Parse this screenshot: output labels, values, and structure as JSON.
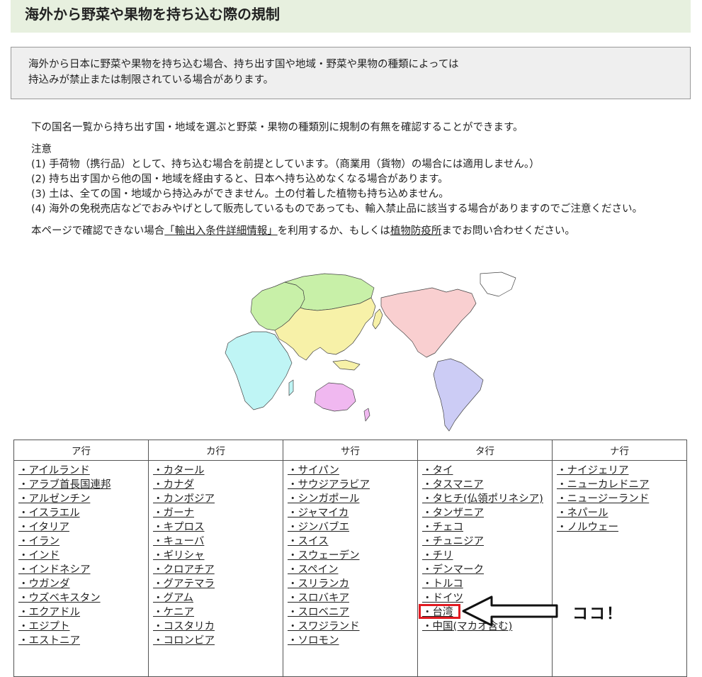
{
  "page": {
    "title": "海外から野菜や果物を持ち込む際の規制"
  },
  "intro": {
    "line1": "海外から日本に野菜や果物を持ち込む場合、持ち出す国や地域・野菜や果物の種類によっては",
    "line2": "持込みが禁止または制限されている場合があります。"
  },
  "body": {
    "lead": "下の国名一覧から持ち出す国・地域を選ぶと野菜・果物の種類別に規制の有無を確認することができます。",
    "notes_title": "注意",
    "notes": [
      "(1) 手荷物（携行品）として、持ち込む場合を前提としています。（商業用（貨物）の場合には適用しません。）",
      "(2) 持ち出す国から他の国・地域を経由すると、日本へ持ち込めなくなる場合があります。",
      "(3) 土は、全ての国・地域から持込みができません。土の付着した植物も持ち込めません。",
      "(4) 海外の免税売店などでおみやげとして販売しているものであっても、輸入禁止品に該当する場合がありますのでご注意ください。"
    ],
    "refer_pre": "本ページで確認できない場合",
    "refer_link": "「輸出入条件詳細情報」",
    "refer_mid": "を利用するか、もしくは",
    "refer_link2": "植物防疫所",
    "refer_post": "までお問い合わせください。"
  },
  "map": {
    "region_colors": {
      "europe": "#c8f0a8",
      "africa": "#bff5f5",
      "asia": "#f7f1a8",
      "oceania": "#f0b8f0",
      "north_america": "#f9cfd0",
      "south_america": "#ccccf5"
    }
  },
  "table": {
    "columns": [
      {
        "header": "ア行",
        "items": [
          "・アイルランド",
          "・アラブ首長国連邦",
          "・アルゼンチン",
          "・イスラエル",
          "・イタリア",
          "・イラン",
          "・インド",
          "・インドネシア",
          "・ウガンダ",
          "・ウズベキスタン",
          "・エクアドル",
          "・エジプト",
          "・エストニア"
        ]
      },
      {
        "header": "カ行",
        "items": [
          "・カタール",
          "・カナダ",
          "・カンボジア",
          "・ガーナ",
          "・キプロス",
          "・キューバ",
          "・ギリシャ",
          "・クロアチア",
          "・グアテマラ",
          "・グアム",
          "・ケニア",
          "・コスタリカ",
          "・コロンビア"
        ]
      },
      {
        "header": "サ行",
        "items": [
          "・サイパン",
          "・サウジアラビア",
          "・シンガポール",
          "・ジャマイカ",
          "・ジンバブエ",
          "・スイス",
          "・スウェーデン",
          "・スペイン",
          "・スリランカ",
          "・スロバキア",
          "・スロベニア",
          "・スワジランド",
          "・ソロモン"
        ]
      },
      {
        "header": "タ行",
        "items": [
          "・タイ",
          "・タスマニア",
          "・タヒチ(仏領ポリネシア)",
          "・タンザニア",
          "・チェコ",
          "・チュニジア",
          "・チリ",
          "・デンマーク",
          "・トルコ",
          "・ドイツ",
          "・台湾",
          "・中国(マカオ含む)"
        ]
      },
      {
        "header": "ナ行",
        "items": [
          "・ナイジェリア",
          "・ニューカレドニア",
          "・ニュージーランド",
          "・ネパール",
          "・ノルウェー"
        ]
      }
    ]
  },
  "annotation": {
    "callout": "ココ！",
    "highlight_color": "#e11b22"
  }
}
